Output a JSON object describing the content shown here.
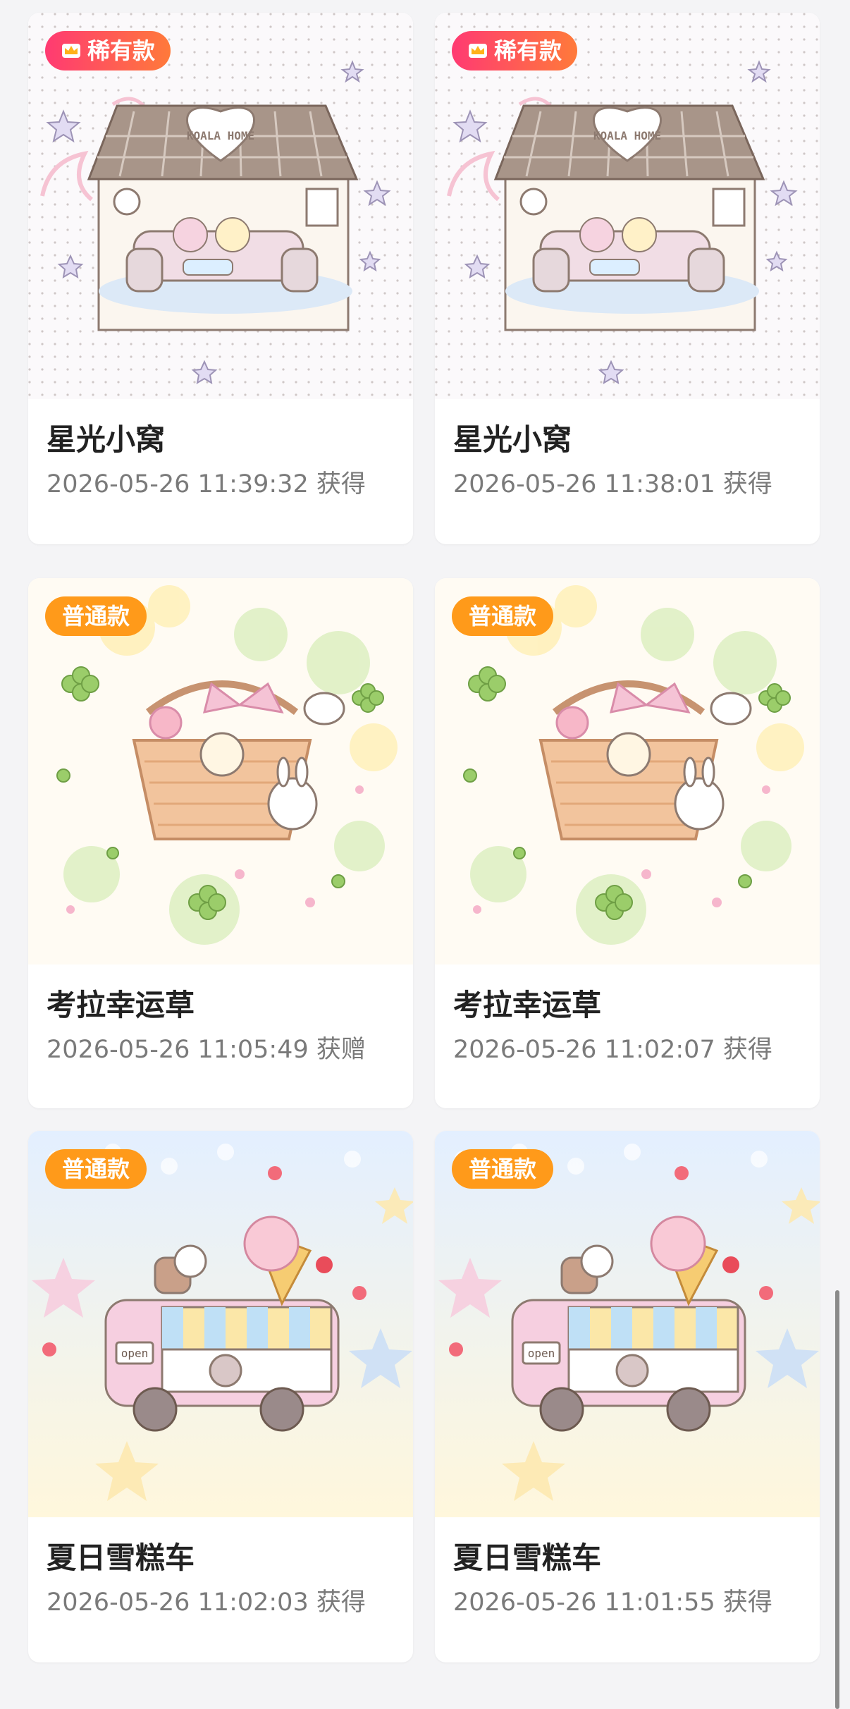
{
  "colors": {
    "rare_badge": "#ff4a6a",
    "normal_badge": "#ff9a1a",
    "title": "#222222",
    "meta": "#7a7a7a"
  },
  "items": [
    {
      "badge": "稀有款",
      "badge_type": "rare",
      "art_sign": "KOALA HOME",
      "title": "星光小窝",
      "time": "2026-05-26 11:39:32 获得"
    },
    {
      "badge": "稀有款",
      "badge_type": "rare",
      "art_sign": "KOALA HOME",
      "title": "星光小窝",
      "time": "2026-05-26 11:38:01 获得"
    },
    {
      "badge": "普通款",
      "badge_type": "normal",
      "title": "考拉幸运草",
      "time": "2026-05-26 11:05:49 获赠"
    },
    {
      "badge": "普通款",
      "badge_type": "normal",
      "title": "考拉幸运草",
      "time": "2026-05-26 11:02:07 获得"
    },
    {
      "badge": "普通款",
      "badge_type": "normal",
      "art_sign": "open",
      "title": "夏日雪糕车",
      "time": "2026-05-26 11:02:03 获得"
    },
    {
      "badge": "普通款",
      "badge_type": "normal",
      "art_sign": "open",
      "title": "夏日雪糕车",
      "time": "2026-05-26 11:01:55 获得"
    }
  ]
}
